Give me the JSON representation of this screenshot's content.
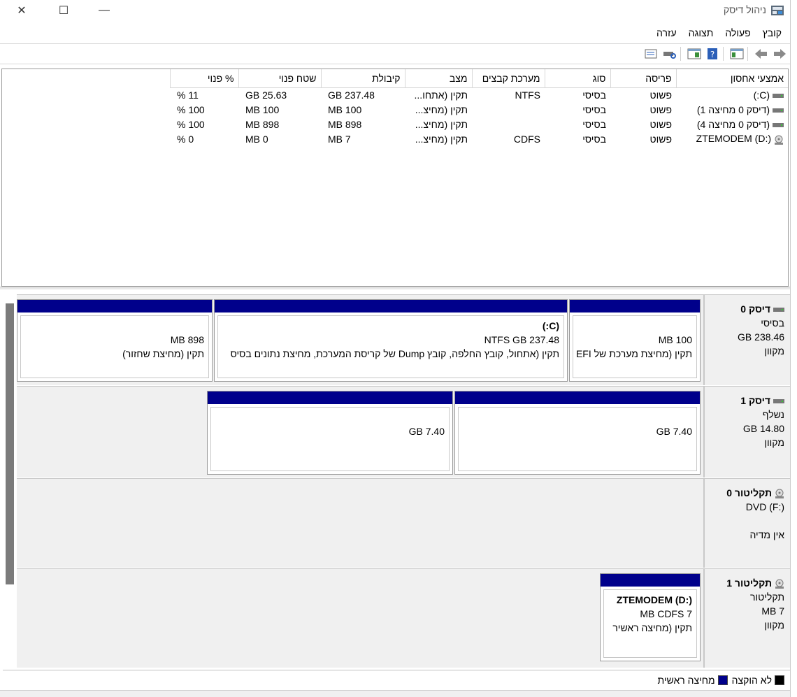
{
  "window": {
    "title": "ניהול דיסק",
    "minimize": "—",
    "maximize": "☐",
    "close": "✕"
  },
  "menu": [
    "קובץ",
    "פעולה",
    "תצוגה",
    "עזרה"
  ],
  "volume_list": {
    "columns": [
      "אמצעי אחסון",
      "פריסה",
      "סוג",
      "מערכת קבצים",
      "מצב",
      "קיבולת",
      "שטח פנוי",
      "% פנוי"
    ],
    "rows": [
      {
        "name": "(C:)",
        "layout": "פשוט",
        "type": "בסיסי",
        "fs": "NTFS",
        "status": "תקין (אתחו...",
        "capacity": "237.48 GB",
        "free": "25.63 GB",
        "pct": "11 %",
        "icon": "drive-icon"
      },
      {
        "name": "(דיסק 0 מחיצה 1)",
        "layout": "פשוט",
        "type": "בסיסי",
        "fs": "",
        "status": "תקין (מחיצ...",
        "capacity": "100 MB",
        "free": "100 MB",
        "pct": "100 %",
        "icon": "drive-icon"
      },
      {
        "name": "(דיסק 0 מחיצה 4)",
        "layout": "פשוט",
        "type": "בסיסי",
        "fs": "",
        "status": "תקין (מחיצ...",
        "capacity": "898 MB",
        "free": "898 MB",
        "pct": "100 %",
        "icon": "drive-icon"
      },
      {
        "name": "ZTEMODEM (D:)",
        "layout": "פשוט",
        "type": "בסיסי",
        "fs": "CDFS",
        "status": "תקין (מחיצ...",
        "capacity": "7 MB",
        "free": "0 MB",
        "pct": "0 %",
        "icon": "cdrom-icon"
      }
    ]
  },
  "disks": [
    {
      "name": "דיסק 0",
      "type": "בסיסי",
      "size": "238.46 GB",
      "state": "מקוון",
      "icon": "disk-icon",
      "partitions": [
        {
          "line1": "100 MB",
          "line2": "תקין (מחיצת מערכת של EFI"
        },
        {
          "title": "(C:)",
          "line1": "237.48 NTFS GB",
          "line2": "תקין (אתחול, קובץ החלפה, קובץ Dump של קריסת המערכת, מחיצת נתונים בסיס"
        },
        {
          "line1": "898 MB",
          "line2": "תקין (מחיצת שחזור)"
        }
      ]
    },
    {
      "name": "דיסק 1",
      "type": "נשלף",
      "size": "14.80 GB",
      "state": "מקוון",
      "icon": "disk-icon",
      "partitions": [
        {
          "line1": "7.40 GB"
        },
        {
          "line1": "7.40 GB"
        }
      ]
    },
    {
      "name": "תקליטור 0",
      "type": "DVD (F:)",
      "state": "אין מדיה",
      "icon": "cdrom-icon"
    },
    {
      "name": "תקליטור 1",
      "type": "תקליטור",
      "size": "7 MB",
      "state": "מקוון",
      "icon": "cdrom-icon",
      "partitions": [
        {
          "title": "ZTEMODEM  (D:)",
          "line1": "7 MB CDFS",
          "line2": "תקין (מחיצה ראשיר"
        }
      ]
    }
  ],
  "legend": [
    {
      "label": "לא הוקצה",
      "color": "#000000"
    },
    {
      "label": "מחיצה ראשית",
      "color": "#00008b"
    }
  ],
  "colors": {
    "primary_partition": "#00008b",
    "unallocated": "#000000"
  }
}
